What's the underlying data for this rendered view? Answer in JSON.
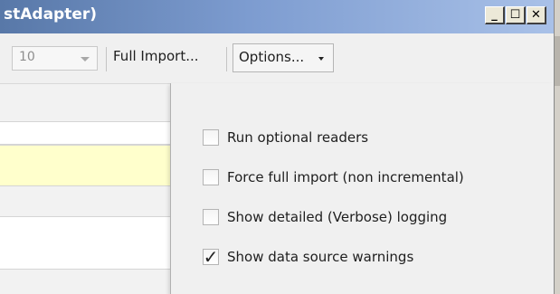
{
  "window": {
    "title": "stAdapter)",
    "controls": {
      "minimize": "_",
      "maximize": "☐",
      "close": "✕"
    }
  },
  "toolbar": {
    "count_value": "10",
    "full_import_label": "Full Import...",
    "options_label": "Options..."
  },
  "options_menu": {
    "items": [
      {
        "label": "Run optional readers",
        "checked": false
      },
      {
        "label": "Force full import (non incremental)",
        "checked": false
      },
      {
        "label": "Show detailed (Verbose) logging",
        "checked": false
      },
      {
        "label": "Show data source warnings",
        "checked": true
      }
    ]
  },
  "icons": {
    "check": "✓",
    "dropdown_arrow": "chevron-down-icon"
  },
  "colors": {
    "titlebar_start": "#5878a8",
    "titlebar_end": "#a9c1e8",
    "highlight_row": "#ffffcc",
    "panel_bg": "#f0f0f0"
  }
}
